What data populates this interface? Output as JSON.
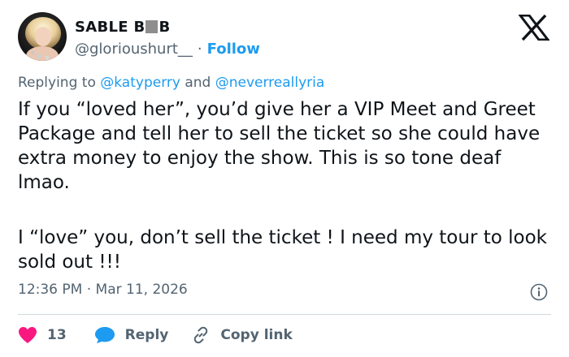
{
  "user": {
    "name_prefix": "SABLE B",
    "name_suffix": "B",
    "handle": "@glorioushurt__",
    "separator": "·",
    "follow_label": "Follow"
  },
  "reply_context": {
    "prefix": "Replying to ",
    "mention_1": "@katyperry",
    "conjunction": " and ",
    "mention_2": "@neverreallyria"
  },
  "tweet": {
    "paragraph_1": "If you “loved her”, you’d give her a VIP Meet and Greet Package and tell her to sell the ticket so she could have extra money to enjoy the show. This is so tone deaf lmao.",
    "paragraph_2": "I “love” you, don’t sell the ticket ! I need my tour to look sold out !!!",
    "timestamp": "12:36 PM · Mar 11, 2026"
  },
  "actions": {
    "like_count": "13",
    "reply_label": "Reply",
    "copy_link_label": "Copy link"
  },
  "icons": {
    "platform": "x-logo-icon",
    "info": "info-icon",
    "like": "heart-icon",
    "reply": "speech-bubble-icon",
    "copy": "link-icon"
  },
  "colors": {
    "accent": "#1d9bf0",
    "like": "#f91880",
    "muted": "#536471",
    "text": "#0f1419"
  }
}
